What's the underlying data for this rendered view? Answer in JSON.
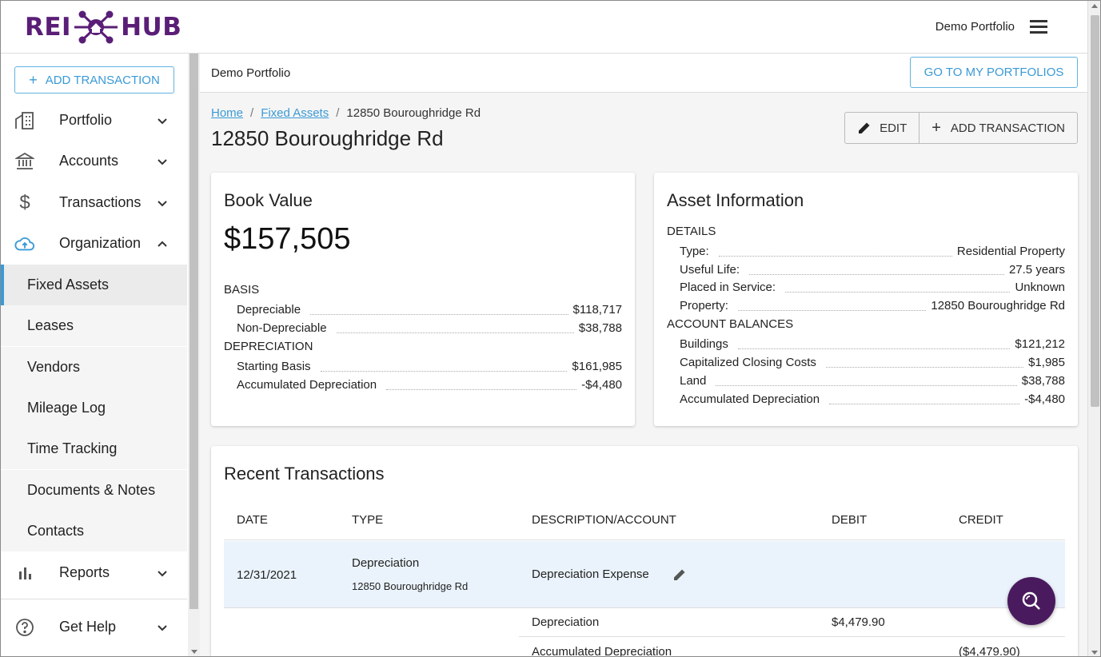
{
  "header": {
    "logo_left": "REI",
    "logo_right": "HUB",
    "portfolio_name": "Demo Portfolio"
  },
  "sidebar": {
    "add_transaction_label": "ADD TRANSACTION",
    "items": [
      {
        "label": "Portfolio",
        "icon": "building-icon"
      },
      {
        "label": "Accounts",
        "icon": "bank-icon"
      },
      {
        "label": "Transactions",
        "icon": "dollar-icon"
      },
      {
        "label": "Organization",
        "icon": "cloud-upload-icon"
      }
    ],
    "subitems": [
      {
        "label": "Fixed Assets",
        "active": true
      },
      {
        "label": "Leases"
      },
      {
        "label": "Vendors"
      },
      {
        "label": "Mileage Log"
      },
      {
        "label": "Time Tracking"
      },
      {
        "label": "Documents & Notes"
      },
      {
        "label": "Contacts"
      }
    ],
    "reports_label": "Reports",
    "help_label": "Get Help"
  },
  "subheader": {
    "title": "Demo Portfolio",
    "goto_label": "GO TO MY PORTFOLIOS"
  },
  "breadcrumb": {
    "home": "Home",
    "fixed_assets": "Fixed Assets",
    "current": "12850 Bouroughridge Rd"
  },
  "page": {
    "title": "12850 Bouroughridge Rd",
    "edit_label": "EDIT",
    "add_transaction_label": "ADD TRANSACTION"
  },
  "book_value": {
    "title": "Book Value",
    "amount": "$157,505",
    "basis_label": "BASIS",
    "basis": [
      {
        "k": "Depreciable",
        "v": "$118,717"
      },
      {
        "k": "Non-Depreciable",
        "v": "$38,788"
      }
    ],
    "depreciation_label": "DEPRECIATION",
    "depreciation": [
      {
        "k": "Starting Basis",
        "v": "$161,985"
      },
      {
        "k": "Accumulated Depreciation",
        "v": "-$4,480"
      }
    ]
  },
  "asset_info": {
    "title": "Asset Information",
    "details_label": "DETAILS",
    "details": [
      {
        "k": "Type:",
        "v": "Residential Property"
      },
      {
        "k": "Useful Life:",
        "v": "27.5 years"
      },
      {
        "k": "Placed in Service:",
        "v": "Unknown"
      },
      {
        "k": "Property:",
        "v": "12850 Bouroughridge Rd"
      }
    ],
    "balances_label": "ACCOUNT BALANCES",
    "balances": [
      {
        "k": "Buildings",
        "v": "$121,212"
      },
      {
        "k": "Capitalized Closing Costs",
        "v": "$1,985"
      },
      {
        "k": "Land",
        "v": "$38,788"
      },
      {
        "k": "Accumulated Depreciation",
        "v": "-$4,480"
      }
    ]
  },
  "recent_transactions": {
    "title": "Recent Transactions",
    "columns": [
      "DATE",
      "TYPE",
      "DESCRIPTION/ACCOUNT",
      "DEBIT",
      "CREDIT"
    ],
    "txn": {
      "date": "12/31/2021",
      "type": "Depreciation",
      "property": "12850 Bouroughridge Rd",
      "description": "Depreciation Expense"
    },
    "lines": [
      {
        "account": "Depreciation",
        "debit": "$4,479.90",
        "credit": ""
      },
      {
        "account": "Accumulated Depreciation",
        "debit": "",
        "credit": "($4,479.90)"
      }
    ]
  },
  "colors": {
    "brand": "#5a1e77",
    "accent": "#3a9ad6",
    "fab": "#4a1a5e"
  }
}
